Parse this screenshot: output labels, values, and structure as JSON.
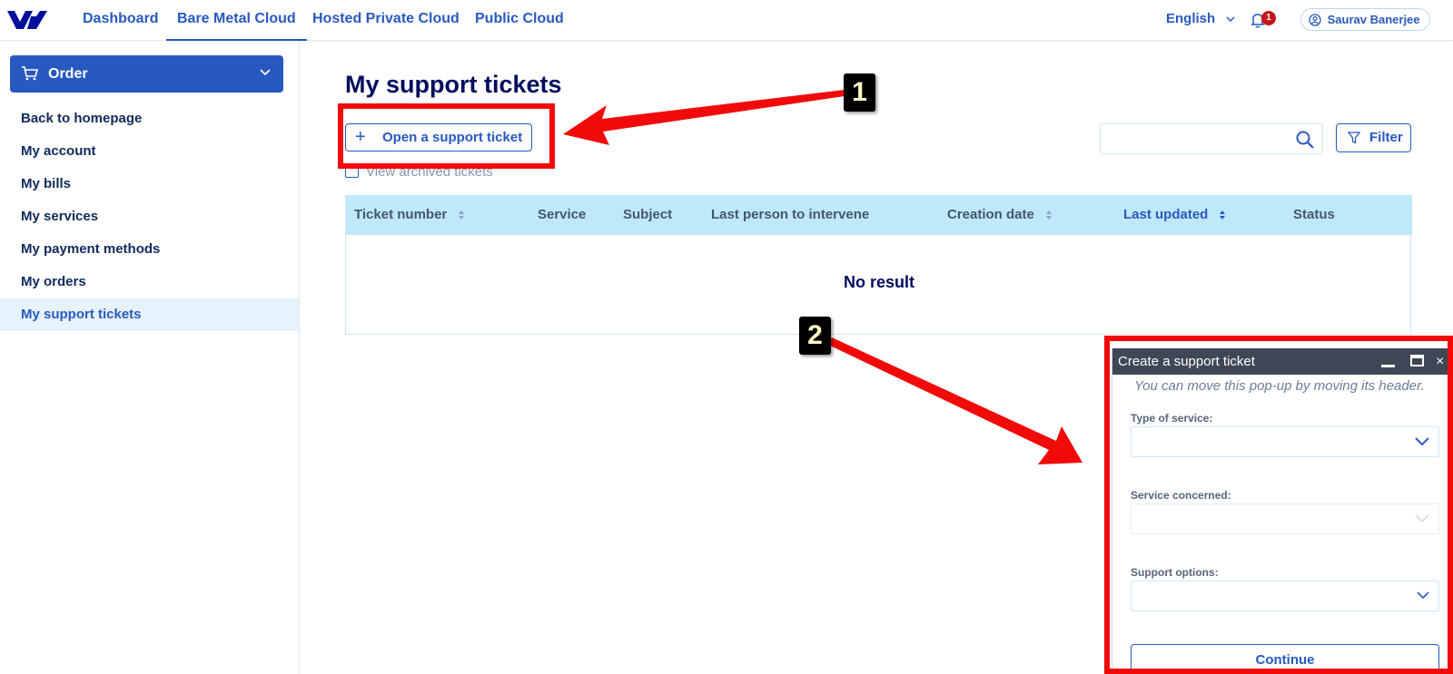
{
  "nav": {
    "items": [
      {
        "label": "Dashboard",
        "active": false
      },
      {
        "label": "Bare Metal Cloud",
        "active": true
      },
      {
        "label": "Hosted Private Cloud",
        "active": false
      },
      {
        "label": "Public Cloud",
        "active": false
      }
    ],
    "language": "English",
    "notification_count": "1",
    "user_name": "Saurav Banerjee"
  },
  "sidebar": {
    "order_label": "Order",
    "items": [
      {
        "label": "Back to homepage",
        "active": false
      },
      {
        "label": "My account",
        "active": false
      },
      {
        "label": "My bills",
        "active": false
      },
      {
        "label": "My services",
        "active": false
      },
      {
        "label": "My payment methods",
        "active": false
      },
      {
        "label": "My orders",
        "active": false
      },
      {
        "label": "My support tickets",
        "active": true
      }
    ]
  },
  "main": {
    "title": "My support tickets",
    "open_ticket_label": "Open a support ticket",
    "archived_label": "View archived tickets",
    "search_placeholder": "",
    "filter_label": "Filter",
    "table": {
      "columns": [
        {
          "label": "Ticket number",
          "sortable": true,
          "sorted": false
        },
        {
          "label": "Service",
          "sortable": false,
          "sorted": false
        },
        {
          "label": "Subject",
          "sortable": false,
          "sorted": false
        },
        {
          "label": "Last person to intervene",
          "sortable": false,
          "sorted": false
        },
        {
          "label": "Creation date",
          "sortable": true,
          "sorted": false
        },
        {
          "label": "Last updated",
          "sortable": true,
          "sorted": true
        },
        {
          "label": "Status",
          "sortable": false,
          "sorted": false
        }
      ],
      "empty_text": "No result"
    }
  },
  "popup": {
    "title": "Create a support ticket",
    "hint": "You can move this pop-up by moving its header.",
    "fields": [
      {
        "label": "Type of service:",
        "value": "",
        "enabled": true
      },
      {
        "label": "Service concerned:",
        "value": "",
        "enabled": false
      },
      {
        "label": "Support options:",
        "value": "",
        "enabled": true
      }
    ],
    "continue_label": "Continue"
  },
  "annotations": {
    "step1": "1",
    "step2": "2"
  },
  "colors": {
    "brand": "#2859c0",
    "header_row": "#bfe9fb",
    "annotation": "#f10a0a",
    "popup_header": "#3f4756"
  }
}
